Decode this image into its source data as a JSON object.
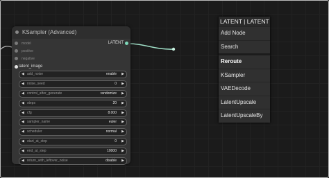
{
  "node": {
    "title": "KSampler (Advanced)",
    "inputs": [
      {
        "label": "model",
        "connected": false
      },
      {
        "label": "positive",
        "connected": false
      },
      {
        "label": "negative",
        "connected": false
      },
      {
        "label": "latent_image",
        "connected": true
      }
    ],
    "output": {
      "label": "LATENT",
      "color": "#7fd8ba"
    },
    "widgets": [
      {
        "name": "add_noise",
        "value": "enable"
      },
      {
        "name": "noise_seed",
        "value": "0"
      },
      {
        "name": "control_after_generate",
        "value": "randomize"
      },
      {
        "name": "steps",
        "value": "20"
      },
      {
        "name": "cfg",
        "value": "8.000"
      },
      {
        "name": "sampler_name",
        "value": "euler"
      },
      {
        "name": "scheduler",
        "value": "normal"
      },
      {
        "name": "start_at_step",
        "value": "0"
      },
      {
        "name": "end_at_step",
        "value": "10000"
      },
      {
        "name": "return_with_leftover_noise",
        "value": "disable"
      }
    ]
  },
  "context_menu": {
    "header": "LATENT | LATENT",
    "items": [
      {
        "label": "Add Node",
        "bold": false,
        "separator": false
      },
      {
        "label": "Search",
        "bold": false,
        "separator": false
      },
      {
        "label": "Reroute",
        "bold": true,
        "separator": true
      },
      {
        "label": "KSampler",
        "bold": false,
        "separator": false
      },
      {
        "label": "VAEDecode",
        "bold": false,
        "separator": false
      },
      {
        "label": "LatentUpscale",
        "bold": false,
        "separator": false
      },
      {
        "label": "LatentUpscaleBy",
        "bold": false,
        "separator": false
      }
    ]
  },
  "colors": {
    "canvas": "#1b1b1b",
    "node_body": "#353535",
    "wire": "#a0e0c8"
  },
  "icons": {
    "arrow_left": "◀",
    "arrow_right": "▶"
  }
}
